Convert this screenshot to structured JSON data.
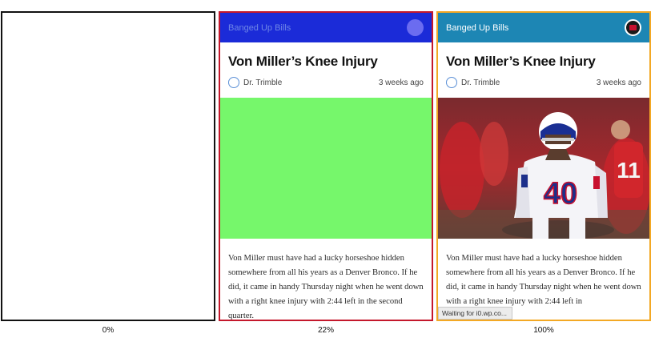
{
  "frames": [
    {
      "caption": "0%"
    },
    {
      "caption": "22%",
      "site_name": "Banged Up Bills",
      "headline": "Von Miller’s Knee Injury",
      "author": "Dr. Trimble",
      "time_ago": "3 weeks ago",
      "body": "Von Miller must have had a lucky horseshoe hidden somewhere from all his years as a Denver Bronco. If he did, it came in handy Thursday night when he went down with a right knee injury with 2:44 left in the second quarter."
    },
    {
      "caption": "100%",
      "site_name": "Banged Up Bills",
      "headline": "Von Miller’s Knee Injury",
      "author": "Dr. Trimble",
      "time_ago": "3 weeks ago",
      "body": "Von Miller must have had a lucky horseshoe hidden somewhere from all his years as a Denver Bronco. If he did, it came in handy Thursday night when he went down with a right knee injury with 2:44 left in",
      "status": "Waiting for i0.wp.co...",
      "jersey_number": "40"
    }
  ],
  "colors": {
    "frame_0_border": "#111111",
    "frame_22_border": "#c4182c",
    "frame_100_border": "#f3a824",
    "appbar_22": "#1b2bd8",
    "appbar_100": "#1d86b4",
    "placeholder_green": "#76f76b"
  },
  "icons": {
    "site_logo": "bills-logo-icon",
    "author_avatar": "avatar-icon"
  }
}
